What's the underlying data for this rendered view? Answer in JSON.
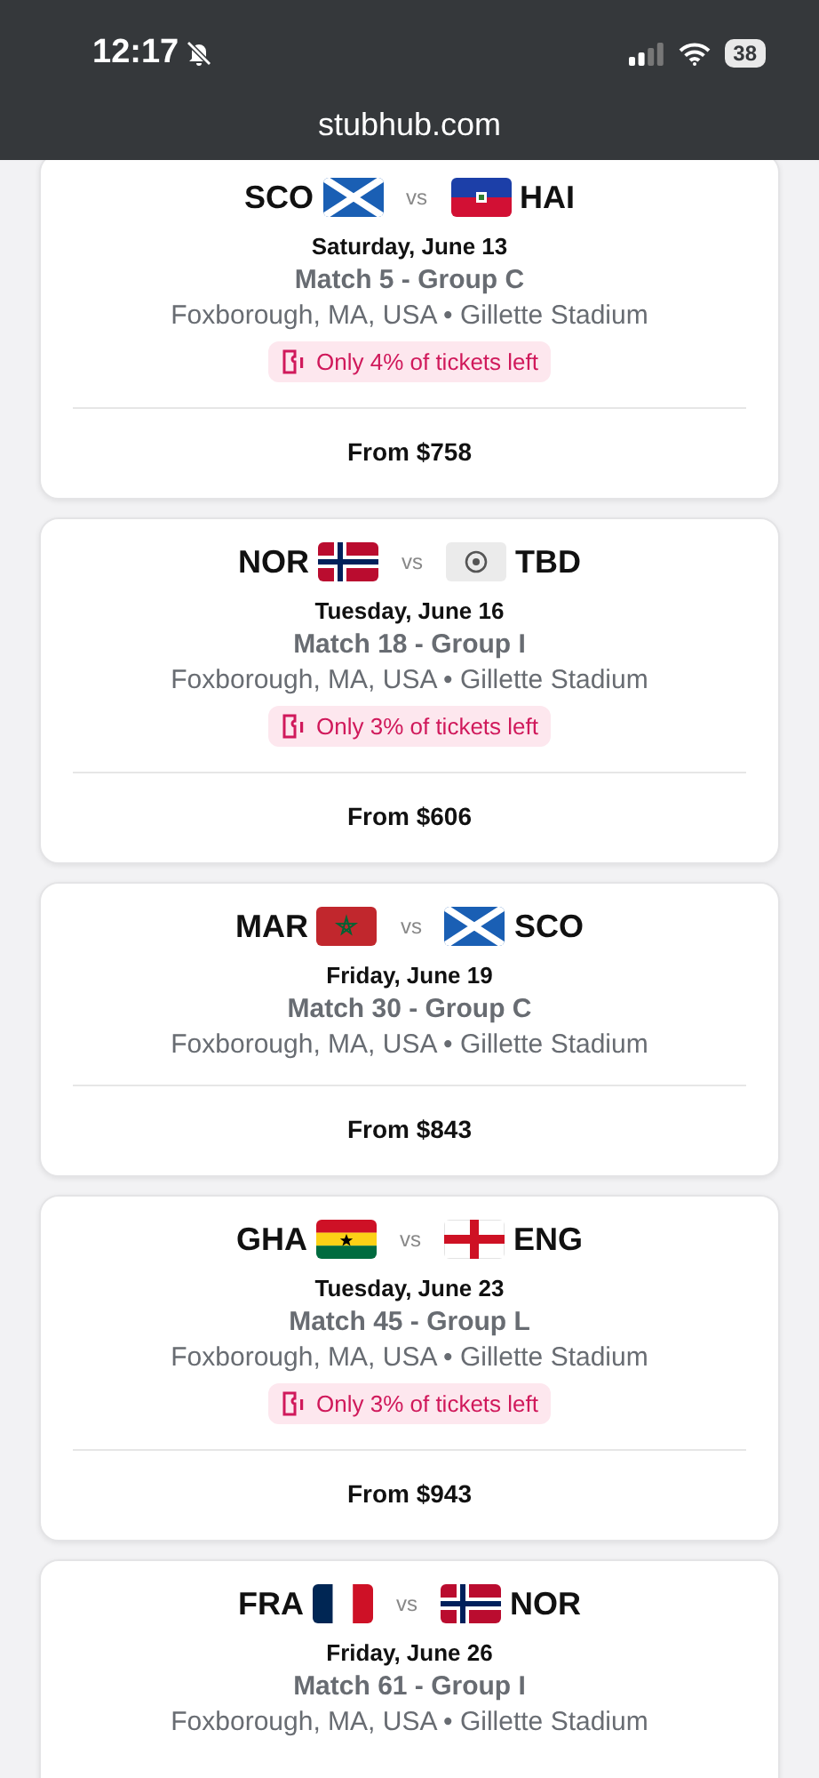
{
  "status_bar": {
    "time": "12:17",
    "battery": "38"
  },
  "address_bar": {
    "url": "stubhub.com"
  },
  "matches": [
    {
      "home": {
        "code": "SCO",
        "kind": "sco"
      },
      "vs": "vs",
      "away": {
        "code": "HAI",
        "kind": "hai"
      },
      "date": "Saturday, June 13",
      "match": "Match 5 - Group C",
      "venue": "Foxborough, MA, USA • Gillette Stadium",
      "badge": "Only 4% of tickets left",
      "price": "From $758"
    },
    {
      "home": {
        "code": "NOR",
        "kind": "nor"
      },
      "vs": "vs",
      "away": {
        "code": "TBD",
        "kind": "tbd"
      },
      "date": "Tuesday, June 16",
      "match": "Match 18 - Group I",
      "venue": "Foxborough, MA, USA • Gillette Stadium",
      "badge": "Only 3% of tickets left",
      "price": "From $606"
    },
    {
      "home": {
        "code": "MAR",
        "kind": "mar"
      },
      "vs": "vs",
      "away": {
        "code": "SCO",
        "kind": "sco"
      },
      "date": "Friday, June 19",
      "match": "Match 30 - Group C",
      "venue": "Foxborough, MA, USA • Gillette Stadium",
      "price": "From $843"
    },
    {
      "home": {
        "code": "GHA",
        "kind": "gha"
      },
      "vs": "vs",
      "away": {
        "code": "ENG",
        "kind": "eng"
      },
      "date": "Tuesday, June 23",
      "match": "Match 45 - Group L",
      "venue": "Foxborough, MA, USA • Gillette Stadium",
      "badge": "Only 3% of tickets left",
      "price": "From $943"
    },
    {
      "home": {
        "code": "FRA",
        "kind": "fra"
      },
      "vs": "vs",
      "away": {
        "code": "NOR",
        "kind": "nor"
      },
      "date": "Friday, June 26",
      "match": "Match 61 - Group I",
      "venue": "Foxborough, MA, USA • Gillette Stadium"
    }
  ]
}
